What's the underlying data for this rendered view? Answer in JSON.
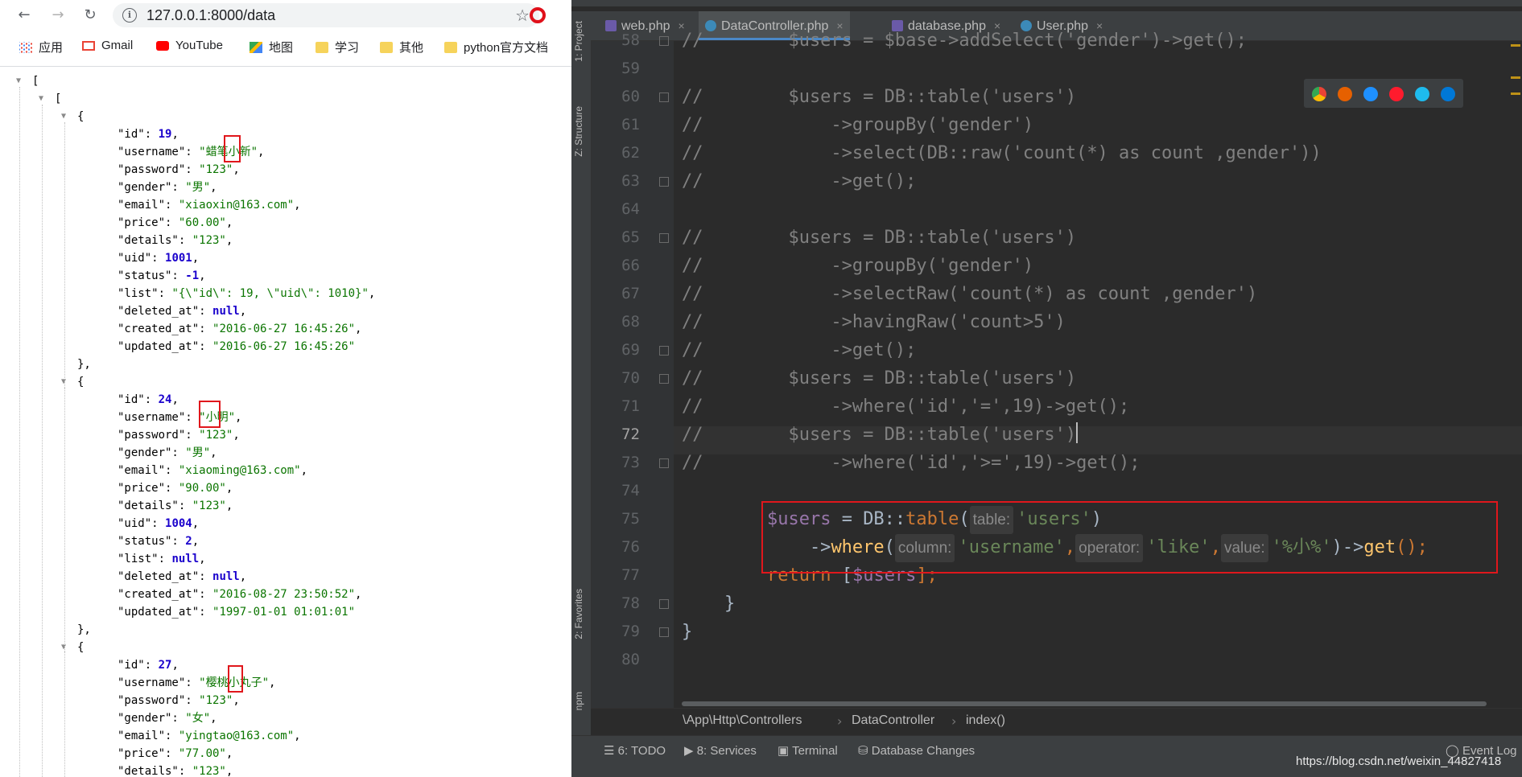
{
  "browser": {
    "url": "127.0.0.1:8000/data",
    "bookmarks": [
      "应用",
      "Gmail",
      "YouTube",
      "地图",
      "学习",
      "其他",
      "python官方文档"
    ],
    "json_lines": [
      {
        "indent": 0,
        "tri": true,
        "parts": [
          {
            "t": "[",
            "c": "k"
          }
        ]
      },
      {
        "indent": 1,
        "tri": true,
        "parts": [
          {
            "t": "[",
            "c": "k"
          }
        ]
      },
      {
        "indent": 2,
        "tri": true,
        "parts": [
          {
            "t": "{",
            "c": "k"
          }
        ]
      },
      {
        "indent": 3,
        "parts": [
          {
            "t": "\"id\": ",
            "c": "k"
          },
          {
            "t": "19",
            "c": "n"
          },
          {
            "t": ",",
            "c": "k"
          }
        ]
      },
      {
        "indent": 3,
        "parts": [
          {
            "t": "\"username\": ",
            "c": "k"
          },
          {
            "t": "\"蜡笔小新\"",
            "c": "s"
          },
          {
            "t": ",",
            "c": "k"
          }
        ]
      },
      {
        "indent": 3,
        "parts": [
          {
            "t": "\"password\": ",
            "c": "k"
          },
          {
            "t": "\"123\"",
            "c": "s"
          },
          {
            "t": ",",
            "c": "k"
          }
        ]
      },
      {
        "indent": 3,
        "parts": [
          {
            "t": "\"gender\": ",
            "c": "k"
          },
          {
            "t": "\"男\"",
            "c": "s"
          },
          {
            "t": ",",
            "c": "k"
          }
        ]
      },
      {
        "indent": 3,
        "parts": [
          {
            "t": "\"email\": ",
            "c": "k"
          },
          {
            "t": "\"xiaoxin@163.com\"",
            "c": "s"
          },
          {
            "t": ",",
            "c": "k"
          }
        ]
      },
      {
        "indent": 3,
        "parts": [
          {
            "t": "\"price\": ",
            "c": "k"
          },
          {
            "t": "\"60.00\"",
            "c": "s"
          },
          {
            "t": ",",
            "c": "k"
          }
        ]
      },
      {
        "indent": 3,
        "parts": [
          {
            "t": "\"details\": ",
            "c": "k"
          },
          {
            "t": "\"123\"",
            "c": "s"
          },
          {
            "t": ",",
            "c": "k"
          }
        ]
      },
      {
        "indent": 3,
        "parts": [
          {
            "t": "\"uid\": ",
            "c": "k"
          },
          {
            "t": "1001",
            "c": "n"
          },
          {
            "t": ",",
            "c": "k"
          }
        ]
      },
      {
        "indent": 3,
        "parts": [
          {
            "t": "\"status\": ",
            "c": "k"
          },
          {
            "t": "-1",
            "c": "n"
          },
          {
            "t": ",",
            "c": "k"
          }
        ]
      },
      {
        "indent": 3,
        "parts": [
          {
            "t": "\"list\": ",
            "c": "k"
          },
          {
            "t": "\"{\\\"id\\\": 19, \\\"uid\\\": 1010}\"",
            "c": "s"
          },
          {
            "t": ",",
            "c": "k"
          }
        ]
      },
      {
        "indent": 3,
        "parts": [
          {
            "t": "\"deleted_at\": ",
            "c": "k"
          },
          {
            "t": "null",
            "c": "nl"
          },
          {
            "t": ",",
            "c": "k"
          }
        ]
      },
      {
        "indent": 3,
        "parts": [
          {
            "t": "\"created_at\": ",
            "c": "k"
          },
          {
            "t": "\"2016-06-27 16:45:26\"",
            "c": "s"
          },
          {
            "t": ",",
            "c": "k"
          }
        ]
      },
      {
        "indent": 3,
        "parts": [
          {
            "t": "\"updated_at\": ",
            "c": "k"
          },
          {
            "t": "\"2016-06-27 16:45:26\"",
            "c": "s"
          }
        ]
      },
      {
        "indent": 2,
        "parts": [
          {
            "t": "},",
            "c": "k"
          }
        ]
      },
      {
        "indent": 2,
        "tri": true,
        "parts": [
          {
            "t": "{",
            "c": "k"
          }
        ]
      },
      {
        "indent": 3,
        "parts": [
          {
            "t": "\"id\": ",
            "c": "k"
          },
          {
            "t": "24",
            "c": "n"
          },
          {
            "t": ",",
            "c": "k"
          }
        ]
      },
      {
        "indent": 3,
        "parts": [
          {
            "t": "\"username\": ",
            "c": "k"
          },
          {
            "t": "\"小明\"",
            "c": "s"
          },
          {
            "t": ",",
            "c": "k"
          }
        ]
      },
      {
        "indent": 3,
        "parts": [
          {
            "t": "\"password\": ",
            "c": "k"
          },
          {
            "t": "\"123\"",
            "c": "s"
          },
          {
            "t": ",",
            "c": "k"
          }
        ]
      },
      {
        "indent": 3,
        "parts": [
          {
            "t": "\"gender\": ",
            "c": "k"
          },
          {
            "t": "\"男\"",
            "c": "s"
          },
          {
            "t": ",",
            "c": "k"
          }
        ]
      },
      {
        "indent": 3,
        "parts": [
          {
            "t": "\"email\": ",
            "c": "k"
          },
          {
            "t": "\"xiaoming@163.com\"",
            "c": "s"
          },
          {
            "t": ",",
            "c": "k"
          }
        ]
      },
      {
        "indent": 3,
        "parts": [
          {
            "t": "\"price\": ",
            "c": "k"
          },
          {
            "t": "\"90.00\"",
            "c": "s"
          },
          {
            "t": ",",
            "c": "k"
          }
        ]
      },
      {
        "indent": 3,
        "parts": [
          {
            "t": "\"details\": ",
            "c": "k"
          },
          {
            "t": "\"123\"",
            "c": "s"
          },
          {
            "t": ",",
            "c": "k"
          }
        ]
      },
      {
        "indent": 3,
        "parts": [
          {
            "t": "\"uid\": ",
            "c": "k"
          },
          {
            "t": "1004",
            "c": "n"
          },
          {
            "t": ",",
            "c": "k"
          }
        ]
      },
      {
        "indent": 3,
        "parts": [
          {
            "t": "\"status\": ",
            "c": "k"
          },
          {
            "t": "2",
            "c": "n"
          },
          {
            "t": ",",
            "c": "k"
          }
        ]
      },
      {
        "indent": 3,
        "parts": [
          {
            "t": "\"list\": ",
            "c": "k"
          },
          {
            "t": "null",
            "c": "nl"
          },
          {
            "t": ",",
            "c": "k"
          }
        ]
      },
      {
        "indent": 3,
        "parts": [
          {
            "t": "\"deleted_at\": ",
            "c": "k"
          },
          {
            "t": "null",
            "c": "nl"
          },
          {
            "t": ",",
            "c": "k"
          }
        ]
      },
      {
        "indent": 3,
        "parts": [
          {
            "t": "\"created_at\": ",
            "c": "k"
          },
          {
            "t": "\"2016-08-27 23:50:52\"",
            "c": "s"
          },
          {
            "t": ",",
            "c": "k"
          }
        ]
      },
      {
        "indent": 3,
        "parts": [
          {
            "t": "\"updated_at\": ",
            "c": "k"
          },
          {
            "t": "\"1997-01-01 01:01:01\"",
            "c": "s"
          }
        ]
      },
      {
        "indent": 2,
        "parts": [
          {
            "t": "},",
            "c": "k"
          }
        ]
      },
      {
        "indent": 2,
        "tri": true,
        "parts": [
          {
            "t": "{",
            "c": "k"
          }
        ]
      },
      {
        "indent": 3,
        "parts": [
          {
            "t": "\"id\": ",
            "c": "k"
          },
          {
            "t": "27",
            "c": "n"
          },
          {
            "t": ",",
            "c": "k"
          }
        ]
      },
      {
        "indent": 3,
        "parts": [
          {
            "t": "\"username\": ",
            "c": "k"
          },
          {
            "t": "\"樱桃小丸子\"",
            "c": "s"
          },
          {
            "t": ",",
            "c": "k"
          }
        ]
      },
      {
        "indent": 3,
        "parts": [
          {
            "t": "\"password\": ",
            "c": "k"
          },
          {
            "t": "\"123\"",
            "c": "s"
          },
          {
            "t": ",",
            "c": "k"
          }
        ]
      },
      {
        "indent": 3,
        "parts": [
          {
            "t": "\"gender\": ",
            "c": "k"
          },
          {
            "t": "\"女\"",
            "c": "s"
          },
          {
            "t": ",",
            "c": "k"
          }
        ]
      },
      {
        "indent": 3,
        "parts": [
          {
            "t": "\"email\": ",
            "c": "k"
          },
          {
            "t": "\"yingtao@163.com\"",
            "c": "s"
          },
          {
            "t": ",",
            "c": "k"
          }
        ]
      },
      {
        "indent": 3,
        "parts": [
          {
            "t": "\"price\": ",
            "c": "k"
          },
          {
            "t": "\"77.00\"",
            "c": "s"
          },
          {
            "t": ",",
            "c": "k"
          }
        ]
      },
      {
        "indent": 3,
        "parts": [
          {
            "t": "\"details\": ",
            "c": "k"
          },
          {
            "t": "\"123\"",
            "c": "s"
          },
          {
            "t": ",",
            "c": "k"
          }
        ]
      }
    ]
  },
  "ide": {
    "tabs": [
      {
        "label": "web.php",
        "icon": "php-file-icon"
      },
      {
        "label": "DataController.php",
        "icon": "php-class-icon",
        "active": true
      },
      {
        "label": "database.php",
        "icon": "php-file-icon"
      },
      {
        "label": "User.php",
        "icon": "php-class-icon"
      }
    ],
    "side_labels": [
      "1: Project",
      "Z: Structure",
      "2: Favorites",
      "npm"
    ],
    "line_numbers": [
      "58",
      "59",
      "60",
      "61",
      "62",
      "63",
      "64",
      "65",
      "66",
      "67",
      "68",
      "69",
      "70",
      "71",
      "72",
      "73",
      "74",
      "75",
      "76",
      "77",
      "78",
      "79",
      "80"
    ],
    "current_line": "72",
    "code_lines": [
      [
        {
          "t": "//        $users = $base->addSelect('gender')->get();",
          "c": "cm"
        }
      ],
      [],
      [
        {
          "t": "//        $users = DB::table('users')",
          "c": "cm"
        }
      ],
      [
        {
          "t": "//            ->groupBy('gender')",
          "c": "cm"
        }
      ],
      [
        {
          "t": "//            ->select(DB::raw('count(*) as count ,gender'))",
          "c": "cm"
        }
      ],
      [
        {
          "t": "//            ->get();",
          "c": "cm"
        }
      ],
      [],
      [
        {
          "t": "//        $users = DB::table('users')",
          "c": "cm"
        }
      ],
      [
        {
          "t": "//            ->groupBy('gender')",
          "c": "cm"
        }
      ],
      [
        {
          "t": "//            ->selectRaw('count(*) as count ,gender')",
          "c": "cm"
        }
      ],
      [
        {
          "t": "//            ->havingRaw('count>5')",
          "c": "cm"
        }
      ],
      [
        {
          "t": "//            ->get();",
          "c": "cm"
        }
      ],
      [
        {
          "t": "//        $users = DB::table('users')",
          "c": "cm"
        }
      ],
      [
        {
          "t": "//            ->where('id','=',19)->get();",
          "c": "cm"
        }
      ],
      [
        {
          "t": "//        $users = DB::table('users')",
          "c": "cm"
        },
        {
          "t": "",
          "c": "caret"
        }
      ],
      [
        {
          "t": "//            ->where('id','>=',19)->get();",
          "c": "cm"
        }
      ],
      [],
      [
        {
          "t": "        ",
          "c": ""
        },
        {
          "t": "$users",
          "c": "var"
        },
        {
          "t": " = DB::",
          "c": ""
        },
        {
          "t": "table",
          "c": "kw"
        },
        {
          "t": "(",
          "c": ""
        },
        {
          "t": "table:",
          "c": "hint"
        },
        {
          "t": "'users'",
          "c": "str"
        },
        {
          "t": ")",
          "c": ""
        }
      ],
      [
        {
          "t": "            ->",
          "c": ""
        },
        {
          "t": "where",
          "c": "fn"
        },
        {
          "t": "(",
          "c": ""
        },
        {
          "t": "column:",
          "c": "hint"
        },
        {
          "t": "'username'",
          "c": "str"
        },
        {
          "t": ",",
          "c": "kw"
        },
        {
          "t": "operator:",
          "c": "hint"
        },
        {
          "t": "'like'",
          "c": "str"
        },
        {
          "t": ",",
          "c": "kw"
        },
        {
          "t": "value:",
          "c": "hint"
        },
        {
          "t": "'%小%'",
          "c": "str"
        },
        {
          "t": ")->",
          "c": ""
        },
        {
          "t": "get",
          "c": "fn"
        },
        {
          "t": "();",
          "c": "kw"
        }
      ],
      [
        {
          "t": "        ",
          "c": ""
        },
        {
          "t": "return",
          "c": "kw"
        },
        {
          "t": " [",
          "c": ""
        },
        {
          "t": "$users",
          "c": "var"
        },
        {
          "t": "];",
          "c": "kw"
        }
      ],
      [
        {
          "t": "    }",
          "c": ""
        }
      ],
      [
        {
          "t": "}",
          "c": ""
        }
      ],
      []
    ],
    "breadcrumb": [
      "\\App\\Http\\Controllers",
      "DataController",
      "index()"
    ],
    "status_items": [
      "6: TODO",
      "8: Services",
      "Terminal",
      "Database Changes",
      "Event Log"
    ],
    "watermark": "https://blog.csdn.net/weixin_44827418"
  },
  "colors": {
    "comment": "#808080",
    "string": "#6a8759",
    "keyword": "#cc7832",
    "variable": "#9876aa",
    "highlight_box": "#e0171c"
  }
}
